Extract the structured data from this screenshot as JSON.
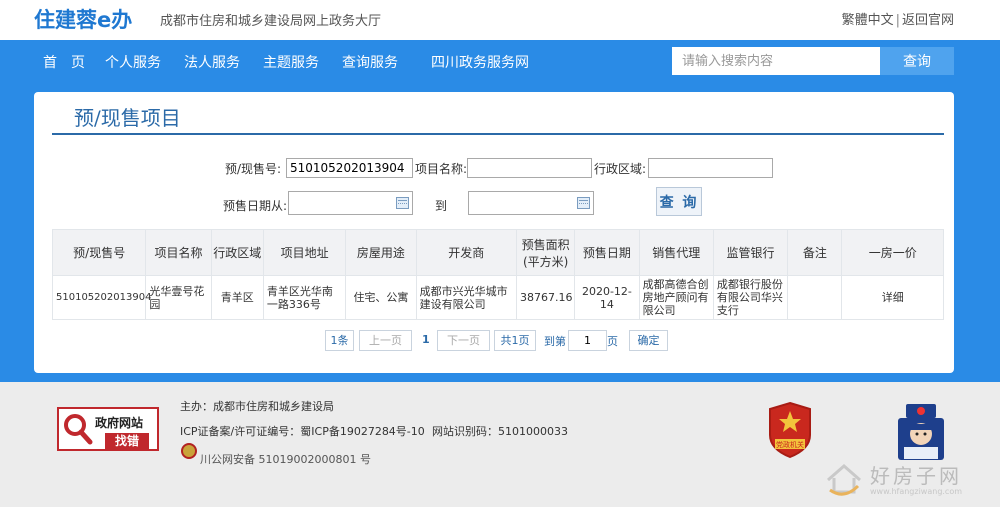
{
  "header": {
    "logo": "住建蓉e办",
    "subtitle": "成都市住房和城乡建设局网上政务大厅",
    "lang_link": "繁體中文",
    "back_link": "返回官网"
  },
  "nav": {
    "items": [
      "首　页",
      "个人服务",
      "法人服务",
      "主题服务",
      "查询服务",
      "四川政务服务网"
    ],
    "search_placeholder": "请输入搜索内容",
    "search_button": "查询"
  },
  "page": {
    "title": "预/现售项目"
  },
  "form": {
    "presale_no_label": "预/现售号:",
    "presale_no_value": "510105202013904",
    "project_name_label": "项目名称:",
    "project_name_value": "",
    "district_label": "行政区域:",
    "district_value": "",
    "date_from_label": "预售日期从:",
    "date_to_label": "到",
    "query_button": "查 询"
  },
  "table": {
    "headers": [
      "预/现售号",
      "项目名称",
      "行政区域",
      "项目地址",
      "房屋用途",
      "开发商",
      "预售面积(平方米)",
      "预售日期",
      "销售代理",
      "监管银行",
      "备注",
      "一房一价"
    ],
    "rows": [
      [
        "510105202013904",
        "光华壹号花园",
        "青羊区",
        "青羊区光华南一路336号",
        "住宅、公寓",
        "成都市兴光华城市建设有限公司",
        "38767.16",
        "2020-12-14",
        "成都高德合创房地产顾问有限公司",
        "成都银行股份有限公司华兴支行",
        "",
        "详细"
      ]
    ]
  },
  "pager": {
    "total": "1条",
    "prev": "上一页",
    "current": "1",
    "next": "下一页",
    "pages": "共1页",
    "goto_prefix": "到第",
    "goto_value": "1",
    "goto_suffix": "页",
    "confirm": "确定"
  },
  "footer": {
    "badge_title": "政府网站",
    "badge_action": "找错",
    "host": "主办：成都市住房和城乡建设局",
    "icp": "ICP证备案/许可证编号：蜀ICP备19027284号-10",
    "site_id": "网站识别码：5101000033",
    "police_record": "川公网安备 51019002000801 号",
    "party_badge_text": "党政机关"
  },
  "watermark": {
    "text": "好房子网",
    "url": "www.hfangziwang.com"
  }
}
